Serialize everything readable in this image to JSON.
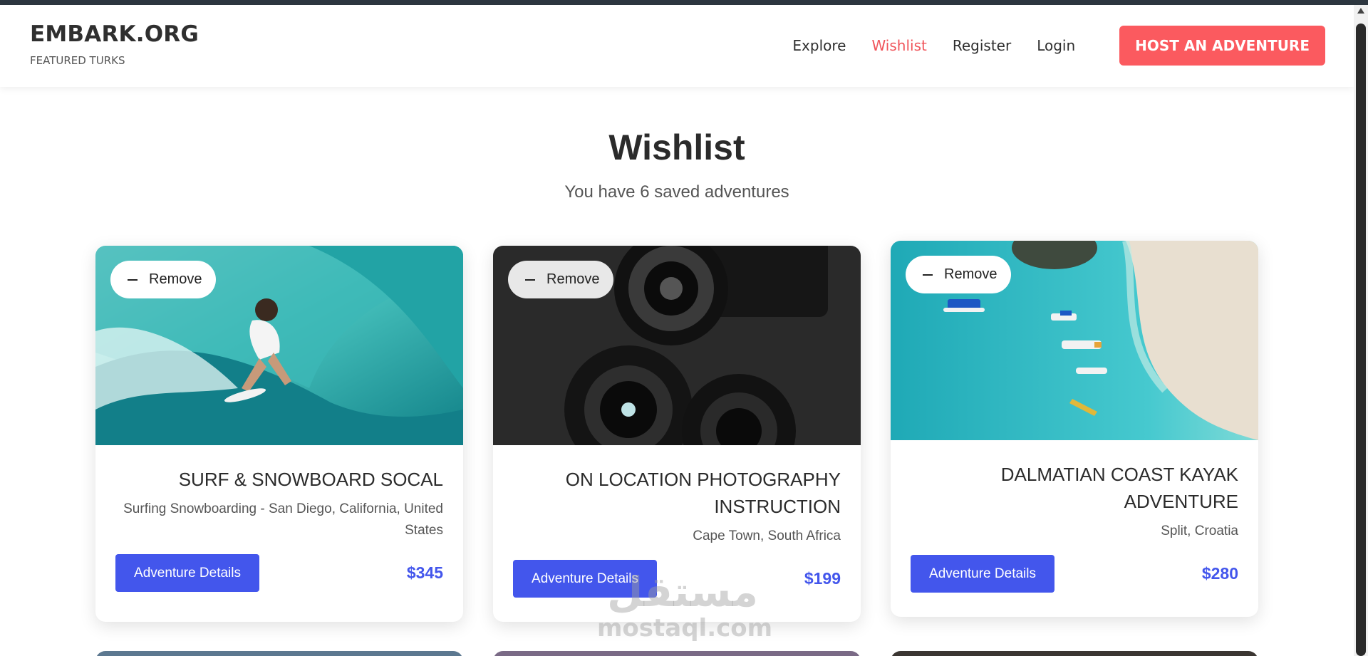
{
  "header": {
    "brand_title": "EMBARK.ORG",
    "brand_subtitle": "FEATURED TURKS",
    "nav": [
      "Explore",
      "Wishlist",
      "Register",
      "Login"
    ],
    "active_nav": "Wishlist",
    "cta": "HOST AN ADVENTURE"
  },
  "page": {
    "title": "Wishlist",
    "subtitle": "You have 6 saved adventures"
  },
  "cards": [
    {
      "remove": "Remove",
      "title": "SURF & SNOWBOARD SOCAL",
      "location": "Surfing Snowboarding - San Diego, California, United States",
      "details": "Adventure Details",
      "price": "$345",
      "image": "surfer-wave-photo"
    },
    {
      "remove": "Remove",
      "title": "ON LOCATION PHOTOGRAPHY INSTRUCTION",
      "location": "Cape Town, South Africa",
      "details": "Adventure Details",
      "price": "$199",
      "image": "camera-lenses-photo"
    },
    {
      "remove": "Remove",
      "title": "DALMATIAN COAST KAYAK ADVENTURE",
      "location": "Split, Croatia",
      "details": "Adventure Details",
      "price": "$280",
      "image": "aerial-beach-boats-photo"
    }
  ],
  "watermark": {
    "arabic": "مستقل",
    "latin": "mostaql.com"
  },
  "colors": {
    "accent": "#fb5a5f",
    "primary": "#4356ec",
    "text": "#2b2b2b"
  }
}
